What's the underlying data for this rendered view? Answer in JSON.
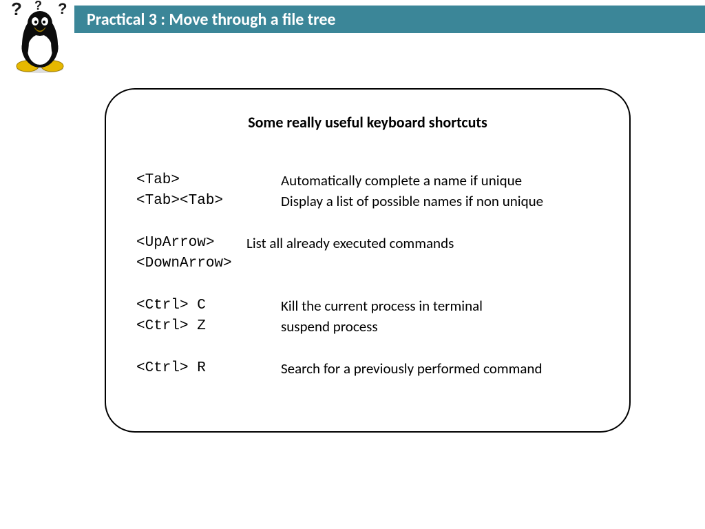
{
  "header": {
    "title": "Practical 3 : Move through a file tree"
  },
  "box": {
    "title": "Some really useful keyboard shortcuts",
    "rows": [
      {
        "key": "<Tab>",
        "desc": "Automatically complete a name if unique"
      },
      {
        "key": "<Tab><Tab>",
        "desc": "Display a list of possible names if non unique"
      },
      {
        "key": "<UpArrow>",
        "desc": "List all already executed commands"
      },
      {
        "key": "<DownArrow>",
        "desc": ""
      },
      {
        "key": "<Ctrl> C",
        "desc": "Kill the current process in terminal"
      },
      {
        "key": "<Ctrl> Z",
        "desc": "suspend process"
      },
      {
        "key": "<Ctrl> R",
        "desc": "Search for a previously performed command"
      }
    ]
  }
}
